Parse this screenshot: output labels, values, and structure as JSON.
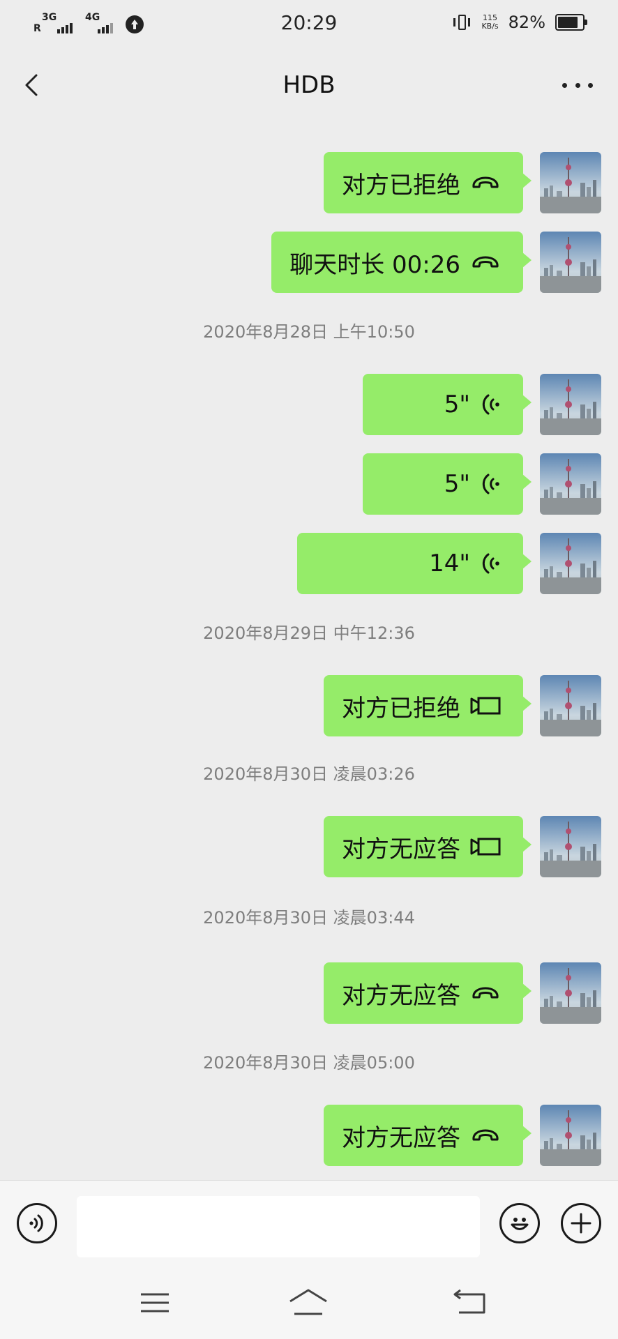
{
  "status_bar": {
    "time": "20:29",
    "sim1": {
      "network": "3G",
      "roaming": "R"
    },
    "sim2": {
      "network": "4G"
    },
    "speed_value": "115",
    "speed_unit": "KB/s",
    "battery_percent": "82%",
    "battery_level": 0.82,
    "icons": [
      "signal-icon",
      "upload-icon",
      "vibrate-icon",
      "battery-icon"
    ]
  },
  "nav": {
    "title": "HDB",
    "back_icon": "chevron-left-icon",
    "more_icon": "more-icon"
  },
  "messages": [
    {
      "kind": "call",
      "text": "对方已拒绝",
      "icon": "phone-hangup-icon"
    },
    {
      "kind": "call",
      "text": "聊天时长 00:26",
      "icon": "phone-hangup-icon"
    },
    {
      "kind": "time",
      "text": "2020年8月28日 上午10:50"
    },
    {
      "kind": "voice",
      "text": "5\"",
      "icon": "voice-wave-icon"
    },
    {
      "kind": "voice",
      "text": "5\"",
      "icon": "voice-wave-icon"
    },
    {
      "kind": "voice",
      "text": "14\"",
      "icon": "voice-wave-icon"
    },
    {
      "kind": "time",
      "text": "2020年8月29日 中午12:36"
    },
    {
      "kind": "video",
      "text": "对方已拒绝",
      "icon": "video-call-icon"
    },
    {
      "kind": "time",
      "text": "2020年8月30日 凌晨03:26"
    },
    {
      "kind": "video",
      "text": "对方无应答",
      "icon": "video-call-icon"
    },
    {
      "kind": "time",
      "text": "2020年8月30日 凌晨03:44"
    },
    {
      "kind": "call",
      "text": "对方无应答",
      "icon": "phone-hangup-icon"
    },
    {
      "kind": "time",
      "text": "2020年8月30日 凌晨05:00"
    },
    {
      "kind": "call",
      "text": "对方无应答",
      "icon": "phone-hangup-icon"
    }
  ],
  "input_bar": {
    "placeholder": "",
    "value": "",
    "icons": [
      "voice-input-icon",
      "emoji-icon",
      "plus-icon"
    ]
  },
  "system_nav": {
    "icons": [
      "menu-icon",
      "home-icon",
      "back-icon"
    ]
  },
  "colors": {
    "bubble_green": "#95ec69",
    "background": "#ededed",
    "timestamp_gray": "#7e7e7e",
    "bar_background": "#f6f6f6"
  }
}
